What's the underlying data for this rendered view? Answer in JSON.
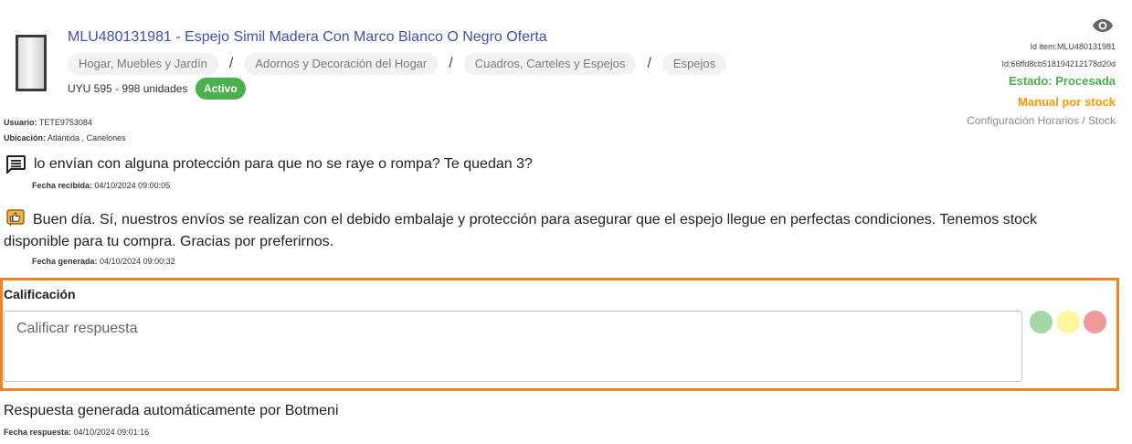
{
  "item": {
    "title": "MLU480131981 - Espejo Simil Madera Con Marco Blanco O Negro Oferta",
    "categories": [
      "Hogar, Muebles y Jardín",
      "Adornos y Decoración del Hogar",
      "Cuadros, Carteles y Espejos",
      "Espejos"
    ],
    "separator": "/",
    "price_units": "UYU 595 - 998 unidades",
    "status_badge": "Activo"
  },
  "user": {
    "usuario_label": "Usuario:",
    "usuario_value": "TETE9753084",
    "ubicacion_label": "Ubicación:",
    "ubicacion_value": "Atlántida , Canelones"
  },
  "meta": {
    "id_item": "Id item:MLU480131981",
    "id": "Id:66ffd8cb518194212178d20d",
    "estado": "Estado: Procesada",
    "manual": "Manual por stock",
    "config": "Configuración Horarios / Stock",
    "colors": {
      "estado": "#4caf50",
      "manual": "#ff9800"
    }
  },
  "question": {
    "icon": "message-icon",
    "text": "lo envían con alguna protección para que no se raye o rompa? Te quedan 3?",
    "date_label": "Fecha recibida:",
    "date_value": "04/10/2024 09:00:05"
  },
  "answer": {
    "icon": "bot-thumb-icon",
    "text": "Buen día. Sí, nuestros envíos se realizan con el debido embalaje y protección para asegurar que el espejo llegue en perfectas condiciones. Tenemos stock disponible para tu compra. Gracias por preferirnos.",
    "date_label": "Fecha generada:",
    "date_value": "04/10/2024 09:00:32"
  },
  "rating": {
    "title": "Calificación",
    "placeholder": "Calificar respuesta",
    "highlight_color": "#f5841f",
    "dots": [
      {
        "name": "rating-good-dot",
        "color": "#a5d6a7"
      },
      {
        "name": "rating-neutral-dot",
        "color": "#fff59d"
      },
      {
        "name": "rating-bad-dot",
        "color": "#ef9a9a"
      }
    ]
  },
  "response": {
    "text": "Respuesta generada automáticamente por Botmeni",
    "date_label": "Fecha respuesta:",
    "date_value": "04/10/2024 09:01:16"
  }
}
